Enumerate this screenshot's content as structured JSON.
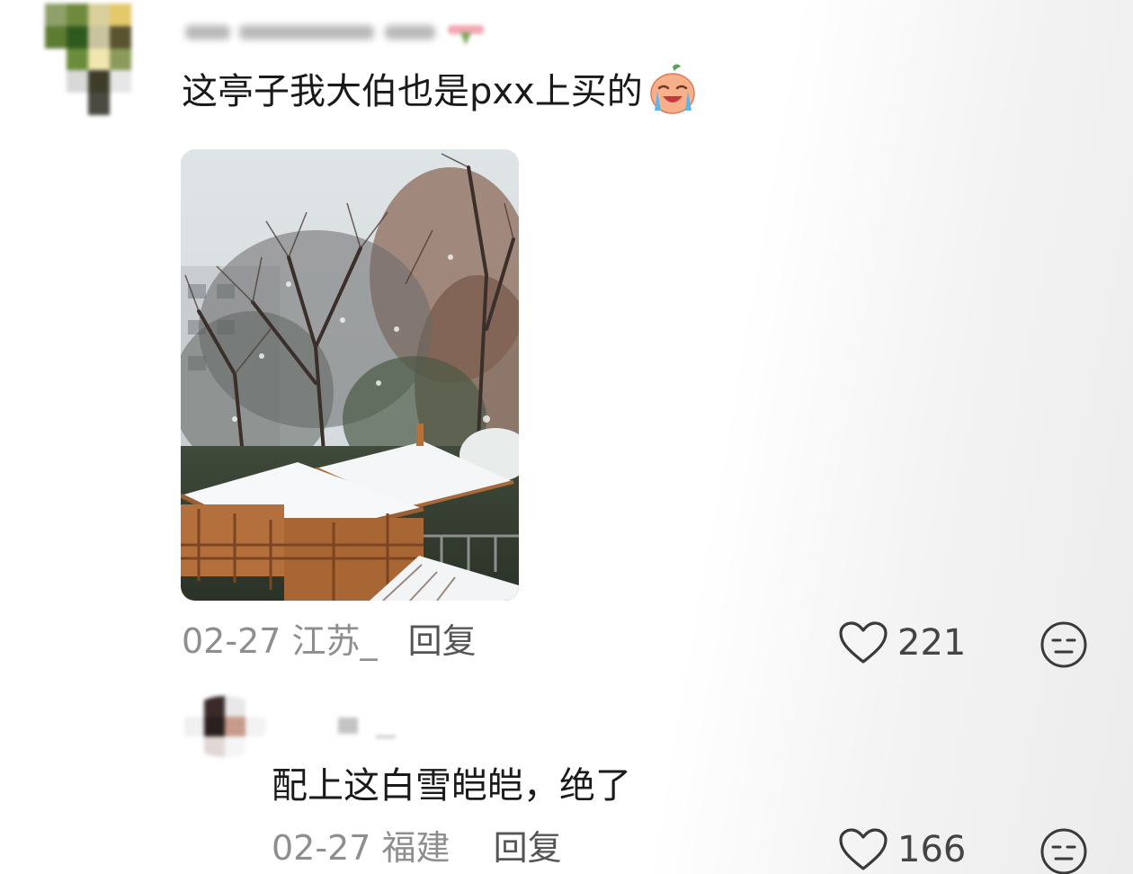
{
  "comments": [
    {
      "text": "这亭子我大伯也是pxx上买的",
      "emoji": "crying-face-emoji",
      "date": "02-27",
      "location": "江苏_",
      "reply_label": "回复",
      "likes": "221",
      "has_photo": true
    },
    {
      "text": "配上这白雪皑皑，绝了",
      "date": "02-27",
      "location": "福建",
      "reply_label": "回复",
      "likes": "166"
    }
  ],
  "icons": {
    "like": "heart-outline-icon",
    "dislike": "neutral-face-icon"
  },
  "colors": {
    "meta_text": "#8e8e8e",
    "comment_text": "#1a1a1a",
    "icon_stroke": "#3a3a3a"
  }
}
